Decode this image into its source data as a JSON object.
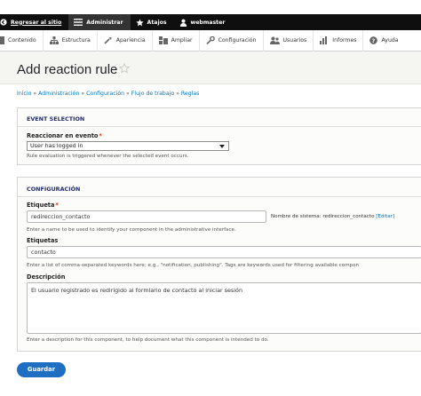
{
  "toolbar": {
    "back_label": "Regresar al sitio",
    "admin_label": "Administrar",
    "shortcuts_label": "Atajos",
    "user_label": "webmaster"
  },
  "tray": {
    "items": [
      {
        "label": "Contenido",
        "icon": "content-icon"
      },
      {
        "label": "Estructura",
        "icon": "structure-icon"
      },
      {
        "label": "Apariencia",
        "icon": "appearance-icon"
      },
      {
        "label": "Ampliar",
        "icon": "extend-icon"
      },
      {
        "label": "Configuración",
        "icon": "wrench-icon"
      },
      {
        "label": "Usuarios",
        "icon": "people-icon"
      },
      {
        "label": "Informes",
        "icon": "reports-icon"
      },
      {
        "label": "Ayuda",
        "icon": "help-icon"
      }
    ]
  },
  "header": {
    "title": "Add reaction rule"
  },
  "breadcrumb": {
    "items": [
      "Inicio",
      "Administración",
      "Configuración",
      "Flujo de trabajo",
      "Reglas"
    ],
    "separator": "»"
  },
  "event_selection": {
    "legend": "EVENT SELECTION",
    "field_label": "Reaccionar en evento",
    "selected": "User has logged in",
    "description": "Rule evaluation is triggered whenever the selected event occurs."
  },
  "configuracion": {
    "legend": "CONFIGURACIÓN",
    "etiqueta_label": "Etiqueta",
    "etiqueta_value": "redireccion_contacto",
    "machine_name_prefix": "Nombre de sistema: redireccion_contacto",
    "machine_edit_link": "[Editar]",
    "etiqueta_description": "Enter a name to be used to identify your component in the administrative interface.",
    "etiquetas_label": "Etiquetas",
    "etiquetas_value": "contacto",
    "etiquetas_description": "Enter a list of comma-separated keywords here; e.g., \"notification, publishing\". Tags are keywords used for filtering available compon",
    "descripcion_label": "Descripción",
    "descripcion_value": "El usuario registrado es redirigido al formlario de contacto al iniciar sesión",
    "descripcion_description": "Enter a description for this component, to help document what this component is intended to do."
  },
  "actions": {
    "save_label": "Guardar"
  },
  "colors": {
    "toolbar_bg": "#0f0f0f",
    "link": "#0074bd",
    "legend": "#222b6a",
    "primary_button": "#1e6ec1",
    "required": "#e62600"
  }
}
